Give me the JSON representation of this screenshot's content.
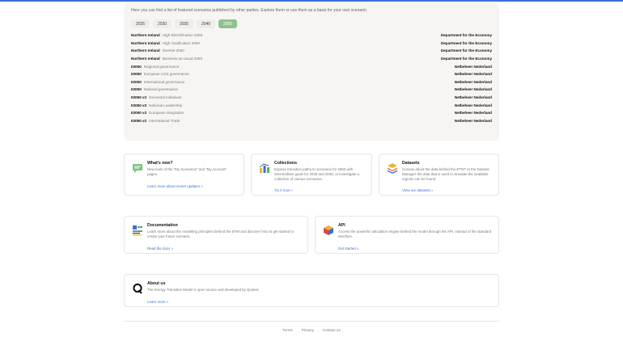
{
  "featured": {
    "intro": "Here you can find a list of featured scenarios published by other parties. Explore them or use them as a basis for your own scenario.",
    "years": [
      "2025",
      "2030",
      "2035",
      "2040",
      "2050"
    ],
    "active_year": "2050",
    "rows": [
      {
        "region": "Northern Ireland",
        "name": "High Electrification 2050",
        "author": "Department for the Economy"
      },
      {
        "region": "Northern Ireland",
        "name": "High Gasification 2050",
        "author": "Department for the Economy"
      },
      {
        "region": "Northern Ireland",
        "name": "Diverse 2050",
        "author": "Department for the Economy"
      },
      {
        "region": "Northern Ireland",
        "name": "Business as Usual 2050",
        "author": "Department for the Economy"
      },
      {
        "region": "II3050",
        "name": "Regional governance",
        "author": "Netbeheer Nederland"
      },
      {
        "region": "II3050",
        "name": "European CO2 governance",
        "author": "Netbeheer Nederland"
      },
      {
        "region": "II3050",
        "name": "International governance",
        "author": "Netbeheer Nederland"
      },
      {
        "region": "II3050",
        "name": "National governance",
        "author": "Netbeheer Nederland"
      },
      {
        "region": "II3050 v2",
        "name": "Decentral Initiatives",
        "author": "Netbeheer Nederland"
      },
      {
        "region": "II3050 v2",
        "name": "National Leadership",
        "author": "Netbeheer Nederland"
      },
      {
        "region": "II3050 v2",
        "name": "European Integration",
        "author": "Netbeheer Nederland"
      },
      {
        "region": "II3050 v2",
        "name": "International Trade",
        "author": "Netbeheer Nederland"
      }
    ]
  },
  "cards": {
    "whats_new": {
      "title": "What's new?",
      "desc": "New tools of the \"My Scenarios\" and \"My Account\" pages.",
      "link": "Learn more about recent updates »",
      "icon": "chat-icon"
    },
    "collections": {
      "title": "Collections",
      "desc": "Explore transition paths to scenarios for 2050 with intermediate goals for 2030 and 2040, or investigate a collection of various scenarios.",
      "link": "Try it now »",
      "icon": "bar-chart-icon"
    },
    "datasets": {
      "title": "Datasets",
      "desc": "Curious about the data behind the ETM? In the Dataset Manager the data that is used to simulate the available regions can be found.",
      "link": "View our datasets »",
      "icon": "layers-icon"
    },
    "documentation": {
      "title": "Documentation",
      "desc": "Learn more about the modelling principles behind the ETM and discover how to get started to create your future scenario.",
      "link": "Read the docs »",
      "icon": "docs-icon"
    },
    "api": {
      "title": "API",
      "desc": "Access the powerful calculation engine behind the model through the API, instead of the standard interface.",
      "link": "Get started »",
      "icon": "cube-icon"
    },
    "about": {
      "title": "About us",
      "desc": "The Energy Transition Model is open source and developed by Quintel.",
      "link": "Learn more »",
      "icon": "quintel-logo-icon"
    }
  },
  "footer": {
    "terms": "Terms",
    "privacy": "Privacy",
    "contact": "Contact us"
  },
  "colors": {
    "accent": "#3b6fd6",
    "active_year": "#8fc18a",
    "panel": "#f7f5f4"
  }
}
